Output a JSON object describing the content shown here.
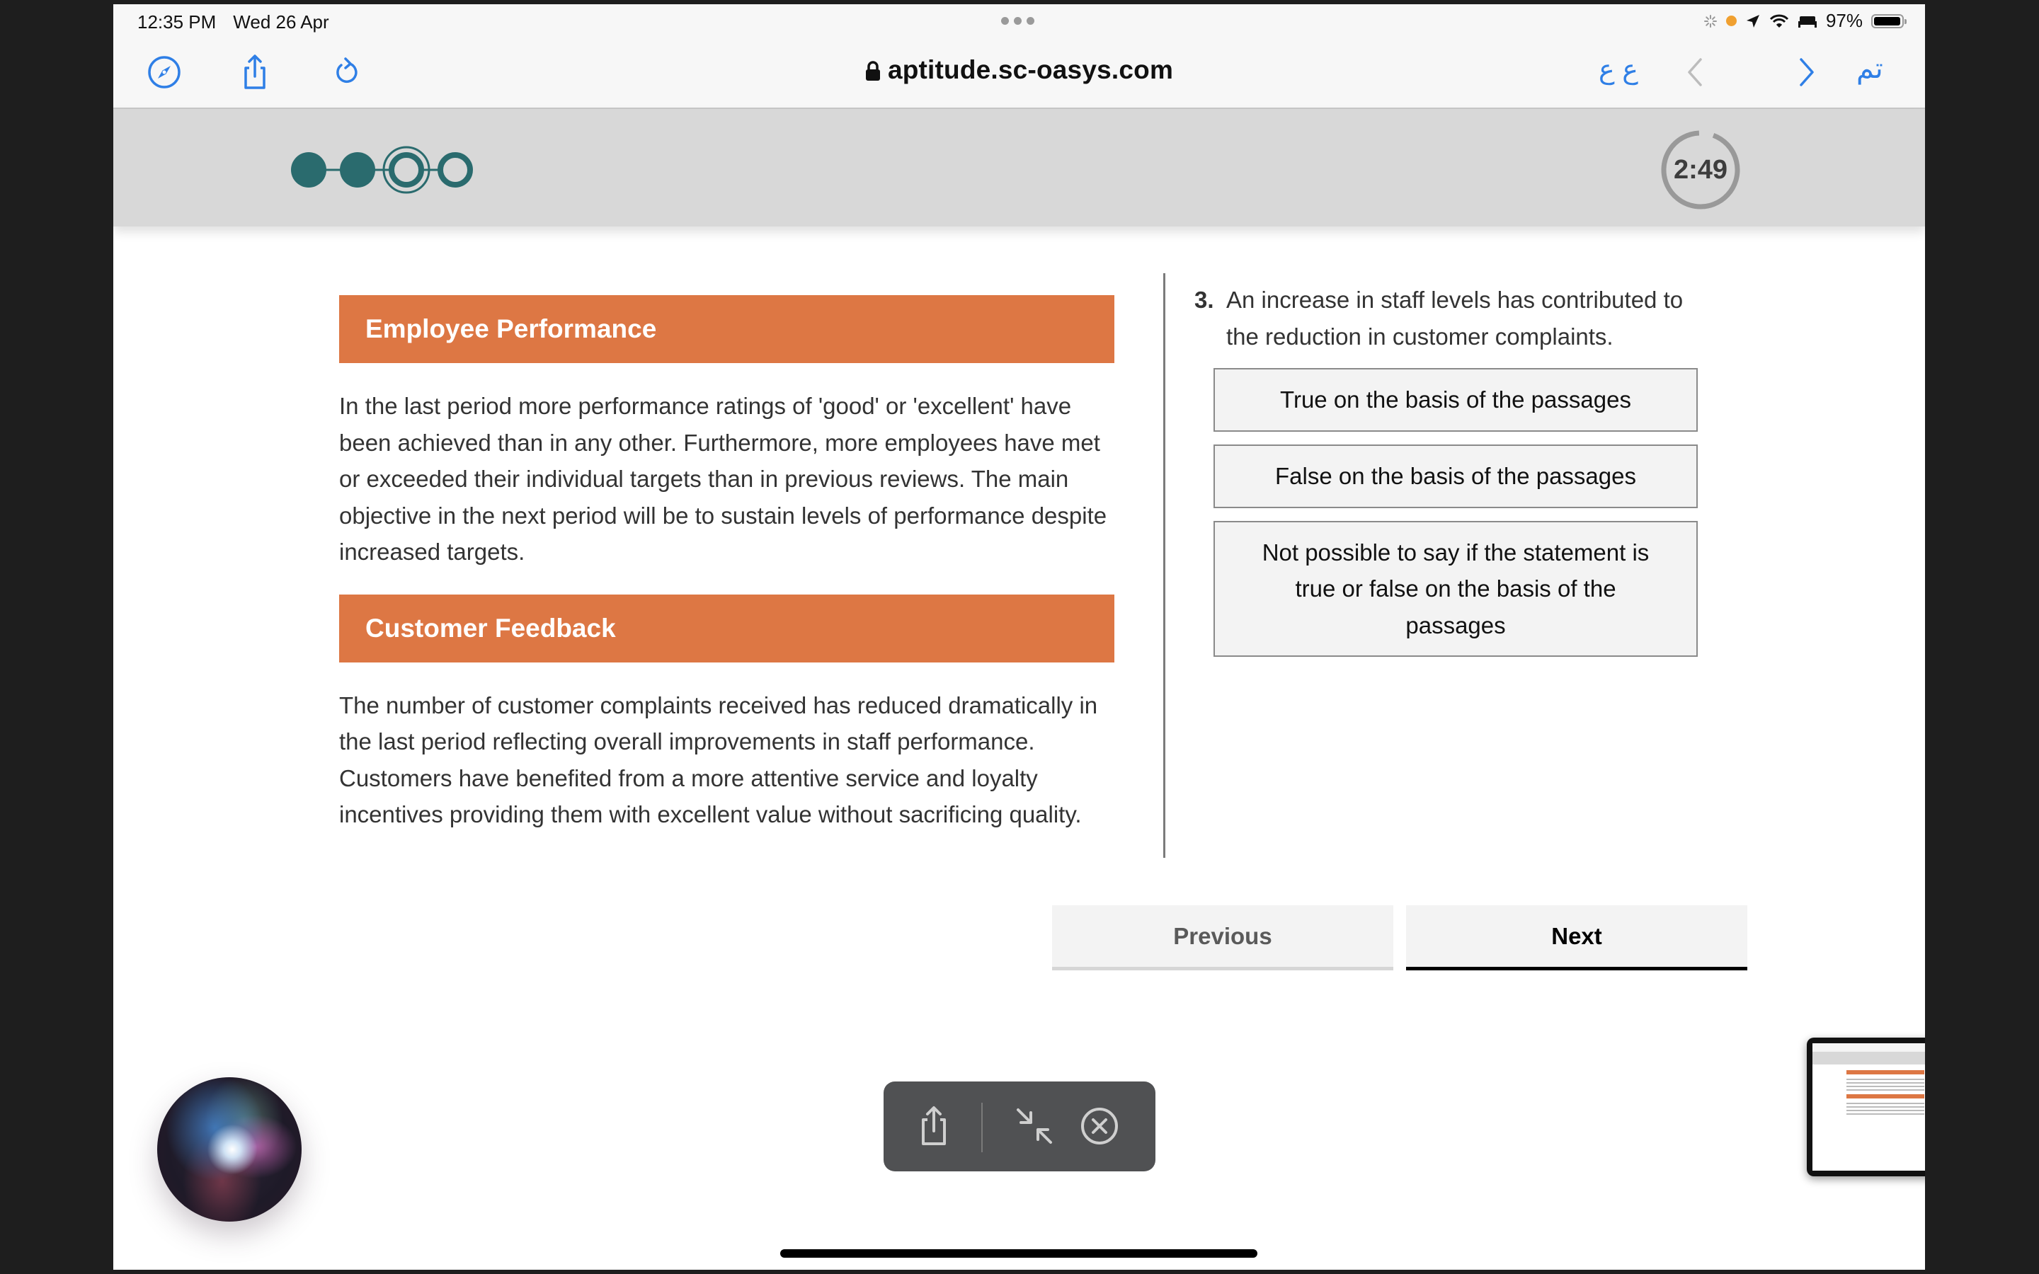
{
  "status_bar": {
    "time": "12:35 PM",
    "date": "Wed 26 Apr",
    "battery_percent": "97%",
    "battery_level": 0.97,
    "icons": [
      "loading-spinner-icon",
      "orange-dot-indicator",
      "location-arrow-icon",
      "wifi-icon",
      "sleep-focus-icon",
      "battery-icon"
    ]
  },
  "toolbar": {
    "url": "aptitude.sc-oasys.com",
    "secure": true,
    "reader_label": "ٴعع",
    "text_size_label": "ع ع",
    "done_label": "تم",
    "icons": [
      "compass-icon",
      "share-icon",
      "reload-icon",
      "back-chevron-icon",
      "forward-chevron-icon"
    ]
  },
  "progress": {
    "total_steps": 4,
    "completed_steps": 2,
    "current_step": 3,
    "accent_color": "#2a6b6e"
  },
  "timer": {
    "text": "2:49",
    "remaining_fraction": 0.95
  },
  "passages": [
    {
      "heading": "Employee Performance",
      "body": "In the last period more performance ratings of 'good' or 'excellent' have been achieved than in any other. Furthermore, more employees have met or exceeded their individual targets than in previous reviews. The main objective in the next period will be to sustain levels of performance despite increased targets."
    },
    {
      "heading": "Customer Feedback",
      "body": "The number of customer complaints received has reduced dramatically in the last period reflecting overall improvements in staff performance. Customers have benefited from a more attentive service and loyalty incentives providing them with excellent value without sacrificing quality."
    }
  ],
  "question": {
    "number": "3.",
    "text": "An increase in staff levels has contributed to the reduction in customer complaints.",
    "options": [
      "True on the basis of the passages",
      "False on the basis of the passages",
      "Not possible to say if the statement is true or false on the basis of the passages"
    ]
  },
  "navigation": {
    "previous_label": "Previous",
    "next_label": "Next"
  },
  "colors": {
    "heading_bg": "#dd7744",
    "progress_teal": "#2a6b6e",
    "link_blue": "#2f7fe6"
  },
  "screenshot_toolbar": {
    "icons": [
      "share-icon",
      "minimize-arrows-icon",
      "close-circle-icon"
    ]
  }
}
